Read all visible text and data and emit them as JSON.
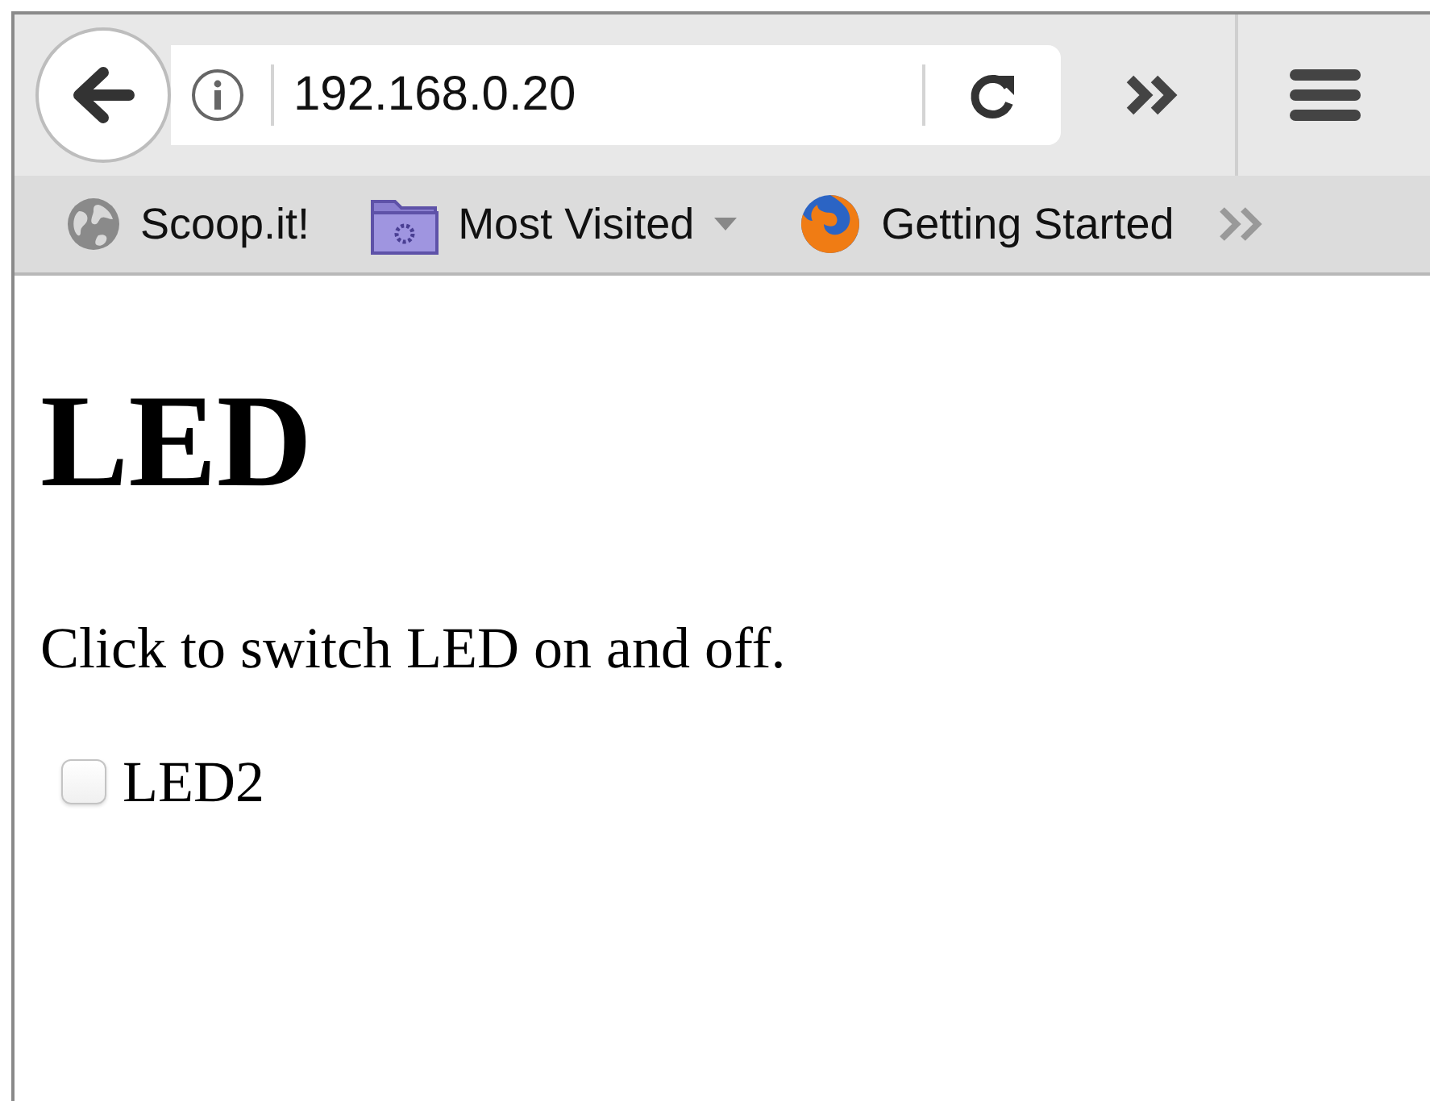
{
  "address_bar": {
    "url": "192.168.0.20"
  },
  "bookmarks": [
    {
      "label": "Scoop.it!",
      "kind": "globe"
    },
    {
      "label": "Most Visited",
      "kind": "folder"
    },
    {
      "label": "Getting Started",
      "kind": "firefox"
    }
  ],
  "page": {
    "heading": "LED",
    "text": "Click to switch LED on and off.",
    "checkboxes": [
      {
        "label": "LED2",
        "checked": false
      }
    ]
  }
}
